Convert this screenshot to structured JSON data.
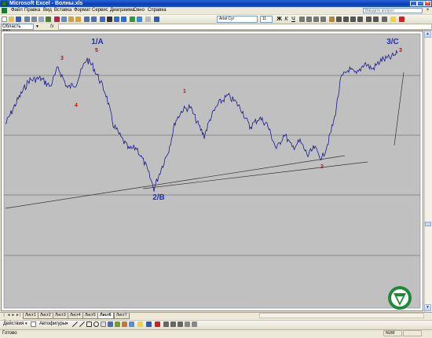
{
  "window": {
    "title": "Microsoft Excel - Волны.xls",
    "minimize": "_",
    "maximize": "□",
    "close": "×"
  },
  "menu": {
    "items": [
      "Файл",
      "Правка",
      "Вид",
      "Вставка",
      "Формат",
      "Сервис",
      "Диаграмма",
      "Окно",
      "Справка"
    ],
    "help_placeholder": "Введите вопрос",
    "doc_close": "×"
  },
  "toolbar": {
    "font_name": "Arial Cyr",
    "font_size": "11"
  },
  "formula_bar": {
    "name_box": "Область диа...",
    "fx_label": "fx"
  },
  "chart": {
    "wave_labels": [
      {
        "text": "1/A",
        "color": "#1f2fbf"
      },
      {
        "text": "2/B",
        "color": "#1f2fbf"
      },
      {
        "text": "3/C",
        "color": "#1f2fbf"
      },
      {
        "text": "3",
        "color": "#e00000"
      },
      {
        "text": "5",
        "color": "#e00000"
      },
      {
        "text": "4",
        "color": "#e00000"
      },
      {
        "text": "1",
        "color": "#e00000"
      },
      {
        "text": "2",
        "color": "#e00000"
      },
      {
        "text": "3",
        "color": "#e00000"
      }
    ],
    "series_color": "#1a1a8c",
    "plot_background": "#c0c0c0",
    "gridline_color": "#555555"
  },
  "sheets": {
    "tabs": [
      "Лист1",
      "Лист2",
      "Лист3",
      "Лист4",
      "Лист5",
      "Лист6",
      "Лист7"
    ],
    "active": "Лист6",
    "nav": [
      "|◄",
      "◄",
      "►",
      "►|"
    ]
  },
  "drawing_toolbar": {
    "actions_label": "Действия",
    "autoshapes_label": "Автофигуры"
  },
  "status": {
    "ready": "Готово",
    "num": "NUM"
  }
}
